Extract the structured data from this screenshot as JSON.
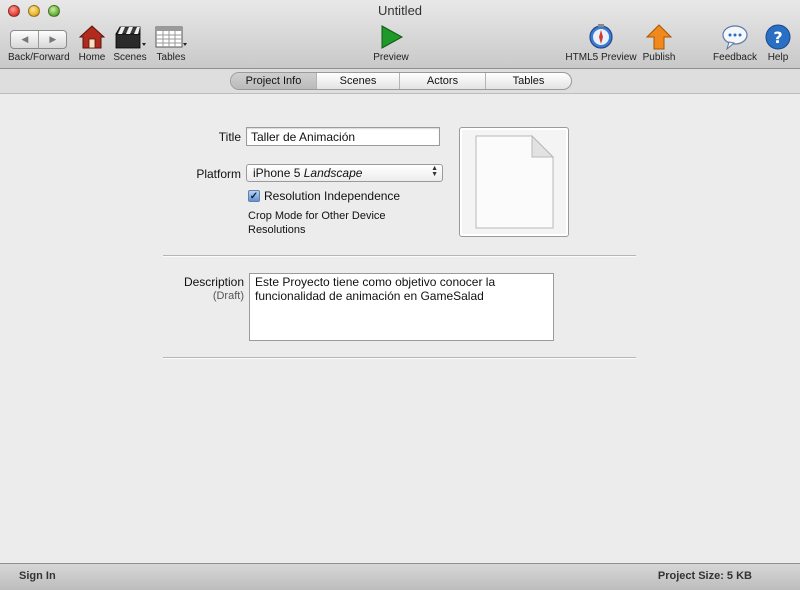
{
  "window": {
    "title": "Untitled"
  },
  "toolbar": {
    "back_forward": "Back/Forward",
    "home": "Home",
    "scenes": "Scenes",
    "tables": "Tables",
    "preview": "Preview",
    "html5_preview": "HTML5 Preview",
    "publish": "Publish",
    "feedback": "Feedback",
    "help": "Help"
  },
  "tabs": [
    {
      "label": "Project Info",
      "active": true
    },
    {
      "label": "Scenes",
      "active": false
    },
    {
      "label": "Actors",
      "active": false
    },
    {
      "label": "Tables",
      "active": false
    }
  ],
  "form": {
    "title_label": "Title",
    "title_value": "Taller de Animación",
    "platform_label": "Platform",
    "platform_device": "iPhone 5",
    "platform_orientation": "Landscape",
    "resolution_independence_label": "Resolution Independence",
    "resolution_independence_checked": true,
    "crop_mode_line1": "Crop Mode for Other Device",
    "crop_mode_line2": "Resolutions",
    "description_label": "Description",
    "description_sublabel": "(Draft)",
    "description_value": "Este Proyecto tiene como objetivo conocer la funcionalidad de animación en GameSalad"
  },
  "statusbar": {
    "sign_in": "Sign In",
    "project_size": "Project Size: 5 KB"
  },
  "colors": {
    "preview_green": "#1f9a2a",
    "publish_orange": "#f08a1c",
    "help_blue": "#2a6fc4",
    "home_red": "#b02a1e"
  }
}
